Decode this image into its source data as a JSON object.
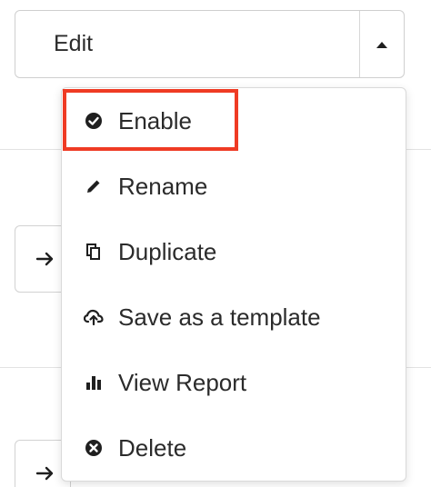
{
  "edit_button": {
    "label": "Edit",
    "caret_icon": "caret-up-icon"
  },
  "menu": {
    "items": [
      {
        "label": "Enable",
        "icon": "check-circle-icon"
      },
      {
        "label": "Rename",
        "icon": "pencil-icon"
      },
      {
        "label": "Duplicate",
        "icon": "copy-icon"
      },
      {
        "label": "Save as a template",
        "icon": "cloud-upload-icon"
      },
      {
        "label": "View Report",
        "icon": "bar-chart-icon"
      },
      {
        "label": "Delete",
        "icon": "close-circle-icon"
      }
    ],
    "highlighted_item": "Enable"
  },
  "colors": {
    "highlight": "#ef3b24",
    "text": "#2b2b2b",
    "border": "#d9d9d9"
  }
}
